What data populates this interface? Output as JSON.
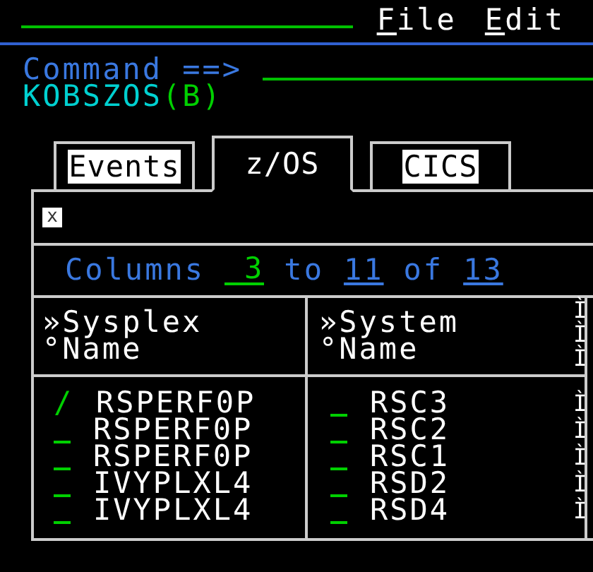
{
  "menu": [
    {
      "label": "File"
    },
    {
      "label": "Edit"
    }
  ],
  "command": {
    "label": "Command ==>"
  },
  "workspace": {
    "name": "KOBSZOS",
    "suffix": "(B)"
  },
  "tabs": [
    {
      "label": "Events",
      "selected": false
    },
    {
      "label": "z/OS",
      "selected": true
    },
    {
      "label": "CICS",
      "selected": false
    }
  ],
  "panel": {
    "close_icon": "x",
    "columns_nav": {
      "prefix": "Columns",
      "from": "3",
      "to_label": "to",
      "to": "11",
      "of_label": "of",
      "total": "13"
    },
    "table": {
      "columns": [
        {
          "lines": [
            "»Sysplex",
            "°Name"
          ]
        },
        {
          "lines": [
            "»System",
            "°Name"
          ]
        },
        {
          "lines": [
            "Ì",
            "Ì",
            "Ì"
          ]
        }
      ],
      "rows": [
        {
          "action_1": "/",
          "sysplex": "RSPERF0P",
          "system": "RSC3",
          "column_3": "Ì"
        },
        {
          "sysplex": "RSPERF0P",
          "system": "RSC2",
          "column_3": "Ì"
        },
        {
          "sysplex": "RSPERF0P",
          "system": "RSC1",
          "column_3": "Ì"
        },
        {
          "sysplex": "IVYPLXL4",
          "system": "RSD2",
          "column_3": "Ì"
        },
        {
          "sysplex": "IVYPLXL4",
          "system": "RSD4",
          "column_3": "Ì"
        }
      ]
    }
  }
}
